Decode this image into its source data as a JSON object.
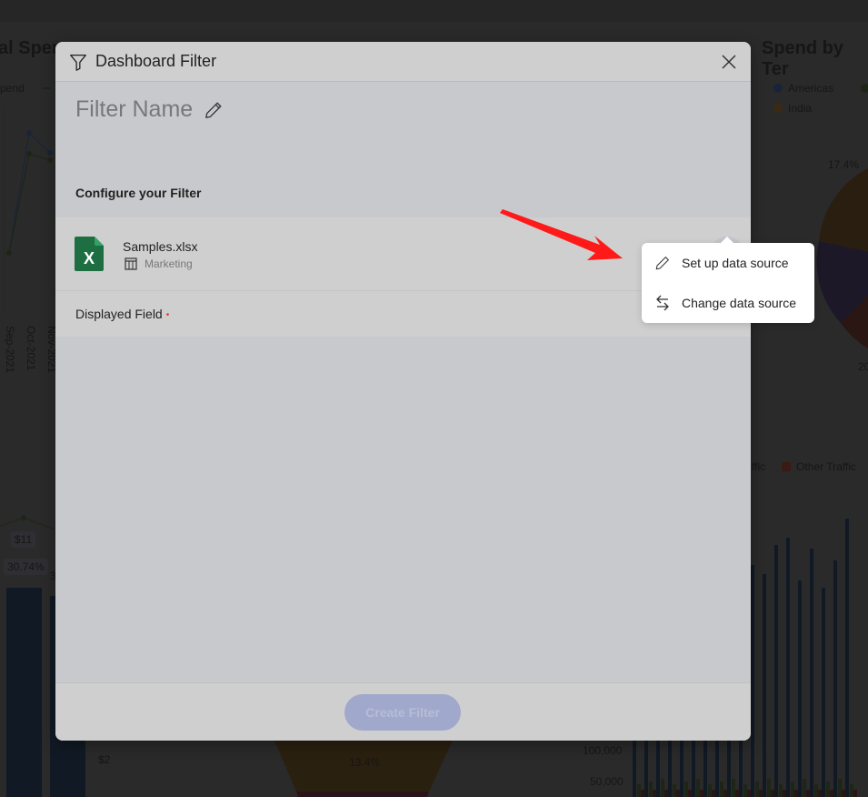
{
  "background": {
    "left_chart": {
      "title_fragment": "al Spen",
      "legend_fragment": "pend",
      "x_ticks": [
        "Sep-2021",
        "Oct-2021",
        "Nov-2021"
      ]
    },
    "right_chart": {
      "title_fragment": "Spend by Ter",
      "legend": [
        {
          "label": "Americas",
          "color": "#1a2438"
        },
        {
          "label": "India",
          "color": "#3a2a14"
        }
      ],
      "pie_labels": [
        "17.4%",
        "20"
      ]
    },
    "bottom_left": {
      "value_label": "$11",
      "percent_label": "30.74%",
      "percent_label_2": "3",
      "axis_label": "$2"
    },
    "bottom_center": {
      "funnel_label": "13.4%"
    },
    "bottom_right": {
      "legend": [
        {
          "label": "ffic",
          "color": "#1d2616"
        },
        {
          "label": "Other Traffic",
          "color": "#3a1a14"
        }
      ],
      "y_ticks": [
        "100,000",
        "50,000"
      ]
    }
  },
  "modal": {
    "title": "Dashboard Filter",
    "filter_name": "Filter Name",
    "configure_label": "Configure your Filter",
    "data_source": {
      "file_name": "Samples.xlsx",
      "sheet_name": "Marketing"
    },
    "displayed_field_label": "Displayed Field",
    "required_marker": "•",
    "create_button": "Create Filter"
  },
  "context_menu": {
    "items": [
      {
        "label": "Set up data source",
        "icon": "pencil-icon"
      },
      {
        "label": "Change data source",
        "icon": "swap-arrows-icon"
      }
    ]
  },
  "colors": {
    "accent_disabled": "#a0a8cc",
    "excel_green": "#1d6f42",
    "annotation_red": "#ff1a1a"
  }
}
